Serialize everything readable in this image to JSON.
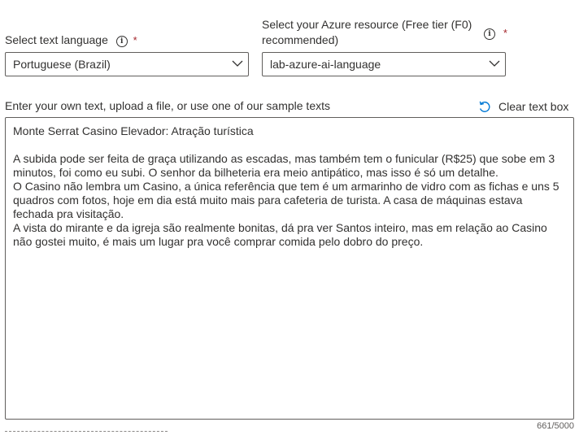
{
  "language": {
    "label": "Select text language",
    "required_mark": "*",
    "info_icon": "info-icon",
    "selected": "Portuguese (Brazil)"
  },
  "resource": {
    "label_line1": "Select your Azure resource (Free tier (F0)",
    "label_line2": "recommended)",
    "required_mark": "*",
    "info_icon": "info-icon",
    "selected": "lab-azure-ai-language"
  },
  "input": {
    "instructions": "Enter your own text, upload a file, or use one of our sample texts",
    "clear_label": "Clear text box",
    "clear_icon": "undo-icon",
    "text": "Monte Serrat Casino Elevador: Atração turística\n\nA subida pode ser feita de graça utilizando as escadas, mas também tem o funicular (R$25) que sobe em 3 minutos, foi como eu subi. O senhor da bilheteria era meio antipático, mas isso é só um detalhe.\nO Casino não lembra um Casino, a única referência que tem é um armarinho de vidro com as fichas e uns 5 quadros com fotos, hoje em dia está muito mais para cafeteria de turista. A casa de máquinas estava fechada pra visitação.\nA vista do mirante e da igreja são realmente bonitas, dá pra ver Santos inteiro, mas em relação ao Casino não gostei muito, é mais um lugar pra você comprar comida pelo dobro do preço.",
    "char_count": "661/5000"
  }
}
